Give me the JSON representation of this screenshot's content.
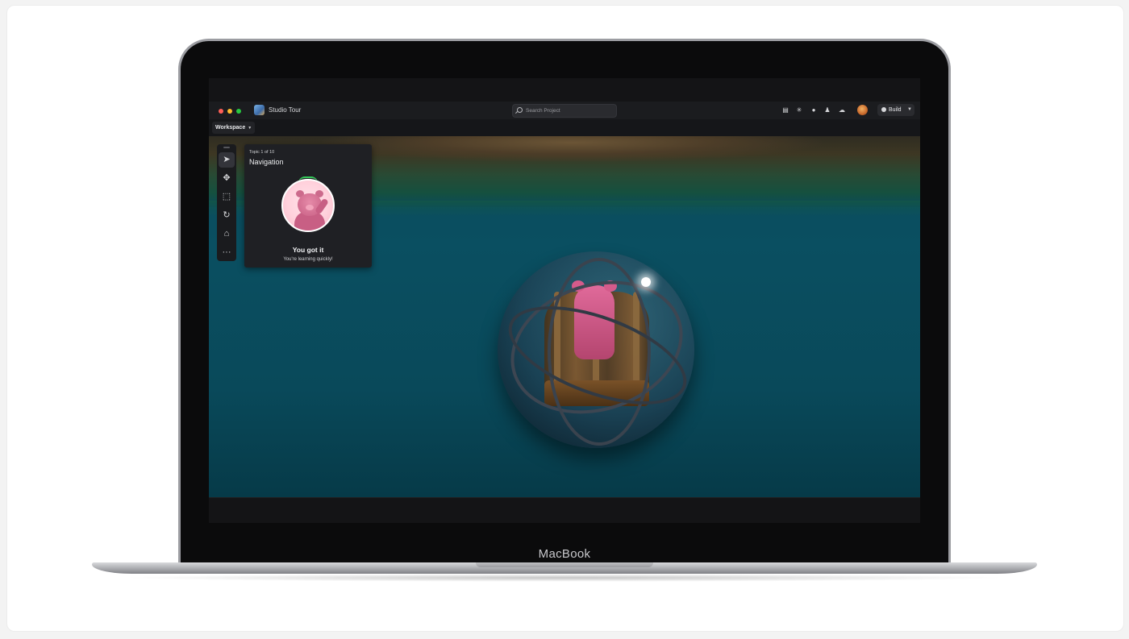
{
  "device": {
    "brand_label": "MacBook"
  },
  "window": {
    "app_title": "Studio Tour",
    "search": {
      "placeholder": "Search Project"
    },
    "header_icons": [
      "notes-icon",
      "sparkle-icon",
      "bell-icon",
      "people-icon",
      "cloud-icon"
    ],
    "build_button": {
      "label": "Build"
    },
    "workspace_button": {
      "label": "Workspace"
    }
  },
  "toolbar": {
    "tools": [
      "select-tool-icon",
      "move-tool-icon",
      "scale-tool-icon",
      "rotate-tool-icon",
      "transform-tool-icon",
      "more-icon"
    ],
    "active_tool": "select"
  },
  "tutorial": {
    "topic_counter": "Topic 1 of 10",
    "topic_title": "Navigation",
    "success_title": "You got it",
    "success_subtitle": "You're learning quickly!"
  },
  "colors": {
    "accent_green": "#34c759",
    "traffic_red": "#ff5f57",
    "traffic_yellow": "#febc2e",
    "traffic_green": "#28c840"
  }
}
